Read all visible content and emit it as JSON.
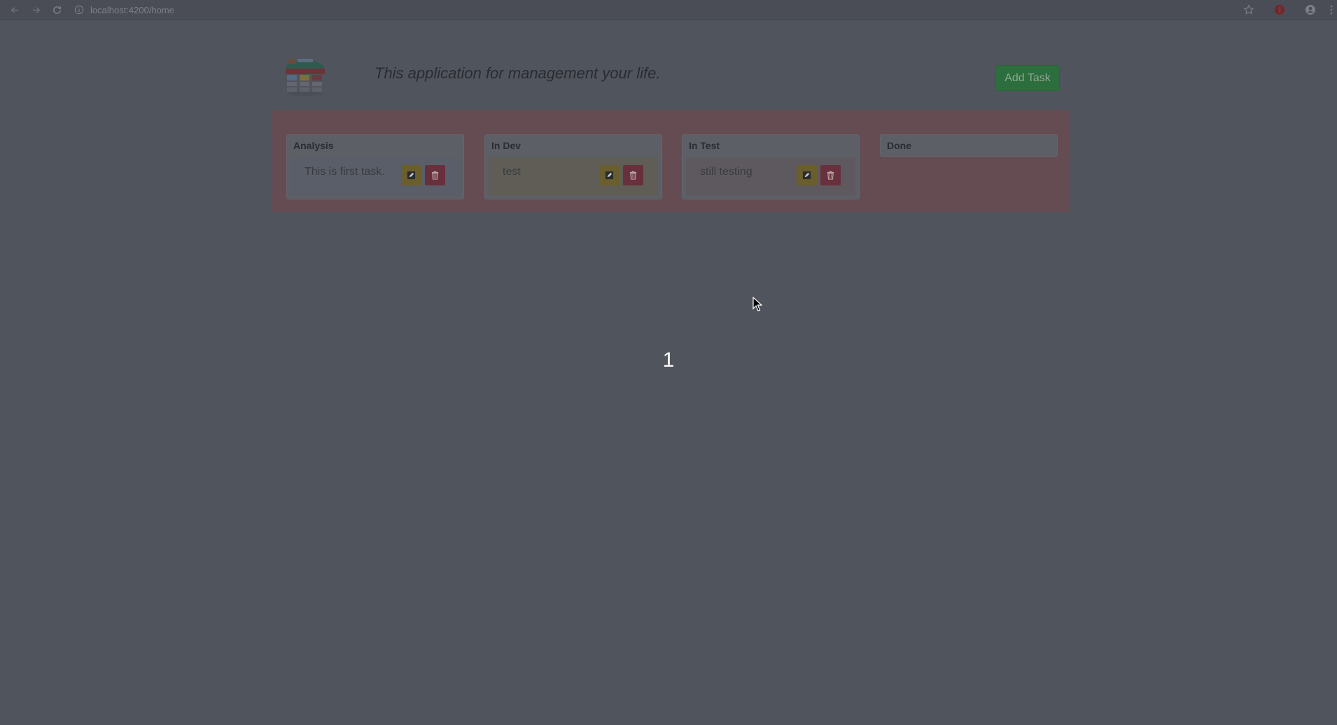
{
  "browser": {
    "url": "localhost:4200/home"
  },
  "header": {
    "tagline": "This application for management your life.",
    "add_button_label": "Add Task"
  },
  "board": {
    "columns": [
      {
        "title": "Analysis",
        "tasks": [
          {
            "text": "This is first task.",
            "color": "#5a5e68"
          }
        ]
      },
      {
        "title": "In Dev",
        "tasks": [
          {
            "text": "test",
            "color": "#5f5d55"
          }
        ]
      },
      {
        "title": "In Test",
        "tasks": [
          {
            "text": "still testing",
            "color": "#5e595e"
          }
        ]
      },
      {
        "title": "Done",
        "tasks": []
      }
    ]
  },
  "counter": "1",
  "colors": {
    "overlay_background": "#50545d",
    "board_background": "#654c52",
    "add_button": "#2c6e3d",
    "edit_button": "#6b5e2d",
    "delete_button": "#68303c"
  }
}
